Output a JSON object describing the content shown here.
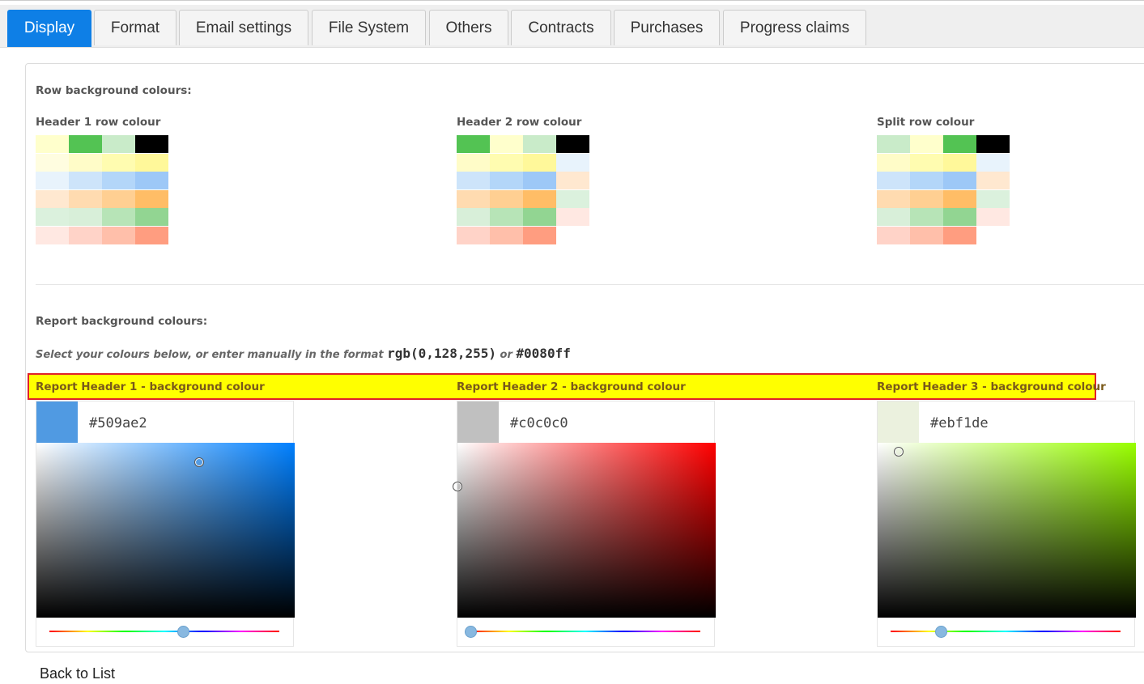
{
  "tabs": [
    "Display",
    "Format",
    "Email settings",
    "File System",
    "Others",
    "Contracts",
    "Purchases",
    "Progress claims"
  ],
  "active_tab": "Display",
  "row_section": {
    "title": "Row background colours:",
    "columns": [
      {
        "label": "Header 1 row colour",
        "swatches": [
          [
            "#ffffcc",
            "#53c353",
            "#c9ebc9",
            "#000000"
          ],
          [
            "#fffde0",
            "#fffcc8",
            "#fffcb0",
            "#fff89a"
          ],
          [
            "#e8f3fc",
            "#cde4fa",
            "#b3d6f9",
            "#9dc8f7"
          ],
          [
            "#ffe8d0",
            "#ffdbb0",
            "#ffcf92",
            "#ffbd66"
          ],
          [
            "#dbf1dd",
            "#d8efd9",
            "#b7e4b7",
            "#92d592"
          ],
          [
            "#ffe8e2",
            "#ffd3c8",
            "#ffbfaa",
            "#ff9d80"
          ]
        ]
      },
      {
        "label": "Header 2 row colour",
        "swatches": [
          [
            "#53c353",
            "#ffffcc",
            "#c9ebc9",
            "#000000"
          ],
          [
            "#fffcc8",
            "#fffcb0",
            "#fff89a",
            "#e8f3fc"
          ],
          [
            "#cde4fa",
            "#b3d6f9",
            "#9dc8f7",
            "#ffe8d0"
          ],
          [
            "#ffdbb0",
            "#ffcf92",
            "#ffbd66",
            "#dbf1dd"
          ],
          [
            "#d8efd9",
            "#b7e4b7",
            "#92d592",
            "#ffe8e2"
          ],
          [
            "#ffd3c8",
            "#ffbfaa",
            "#ff9d80",
            ""
          ]
        ]
      },
      {
        "label": "Split row colour",
        "swatches": [
          [
            "#c9ebc9",
            "#ffffcc",
            "#53c353",
            "#000000"
          ],
          [
            "#fffcc8",
            "#fffcb0",
            "#fff89a",
            "#e8f3fc"
          ],
          [
            "#cde4fa",
            "#b3d6f9",
            "#9dc8f7",
            "#ffe8d0"
          ],
          [
            "#ffdbb0",
            "#ffcf92",
            "#ffbd66",
            "#dbf1dd"
          ],
          [
            "#d8efd9",
            "#b7e4b7",
            "#92d592",
            "#ffe8e2"
          ],
          [
            "#ffd3c8",
            "#ffbfaa",
            "#ff9d80",
            ""
          ]
        ]
      }
    ]
  },
  "report_section": {
    "title": "Report background colours:",
    "hint_prefix": "Select your colours below, or enter manually in the format",
    "hint_rgb": "rgb(0,128,255)",
    "hint_or": "or",
    "hint_hex": "#0080ff",
    "pickers": [
      {
        "label": "Report Header 1 - background colour",
        "value": "#509ae2",
        "hue_color": "#0080ff",
        "hue_fraction": 0.58,
        "saturation": 0.63,
        "brightness": 0.89
      },
      {
        "label": "Report Header 2 - background colour",
        "value": "#c0c0c0",
        "hue_color": "#ff0000",
        "hue_fraction": 0.0,
        "saturation": 0.0,
        "brightness": 0.75
      },
      {
        "label": "Report Header 3 - background colour",
        "value": "#ebf1de",
        "hue_color": "#99ff00",
        "hue_fraction": 0.22,
        "saturation": 0.08,
        "brightness": 0.95
      }
    ]
  },
  "back_link": "Back to List"
}
